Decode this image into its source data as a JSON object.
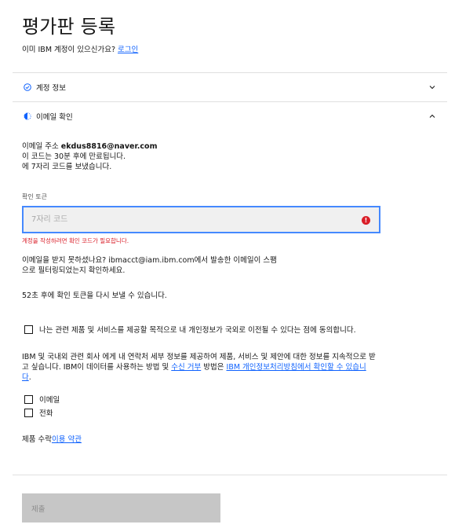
{
  "header": {
    "title": "평가판 등록",
    "subtitle_prefix": "이미 IBM 계정이 있으신가요? ",
    "login_link": "로그인"
  },
  "accordion": {
    "account_info_label": "계정 정보",
    "email_verify_label": "이메일 확인"
  },
  "email_info": {
    "line1_prefix": "이메일 주소 ",
    "email": "ekdus8816@naver.com",
    "line2": "이 코드는 30분 후에 만료됩니다.",
    "line3": "에 7자리 코드를 보냈습니다."
  },
  "token": {
    "label": "확인 토큰",
    "placeholder": "7자리 코드",
    "value": "",
    "error_icon": "!",
    "error_text": "계정을 작성하려면 확인 코드가 필요합니다."
  },
  "help": {
    "line1": "이메일을 받지 못하셨나요? ibmacct@iam.ibm.com에서 발송한 이메일이 스팸",
    "line2": "으로 필터링되었는지 확인하세요.",
    "resend": "52초 후에 확인 토큰을 다시 보낼 수 있습니다."
  },
  "consent": {
    "transfer_label": "나는 관련 제품 및 서비스를 제공할 목적으로 내 개인정보가 국외로 이전될 수 있다는 점에 동의합니다.",
    "marketing_line1": "IBM 및 국내외 관련 회사 에게 내 연락처 세부 정보를 제공하여 제품, 서비스 및 제안에 대한 정보를 지속적으로 받",
    "marketing_line2_prefix": "고 싶습니다. IBM이 데이터를 사용하는 방법 및 ",
    "optout_link": "수신 거부",
    "marketing_line2_mid": " 방법은 ",
    "privacy_link_part1": "IBM 개인정보처리방침에서 확인할 수 있습니",
    "privacy_link_part2": "다",
    "marketing_line3_suffix": ".",
    "email_option": "이메일",
    "phone_option": "전화"
  },
  "terms": {
    "prefix": "제품 수락",
    "link": "이용 약관"
  },
  "submit_label": "제출",
  "colors": {
    "link": "#0f62fe",
    "focus": "#4589ff",
    "error": "#da1e28",
    "disabled_button": "#c6c6c6"
  },
  "icons": {
    "account_info": "checkmark-outline-icon",
    "email_verify": "half-circle-progress-icon",
    "collapsed": "chevron-down-icon",
    "expanded": "chevron-up-icon"
  }
}
